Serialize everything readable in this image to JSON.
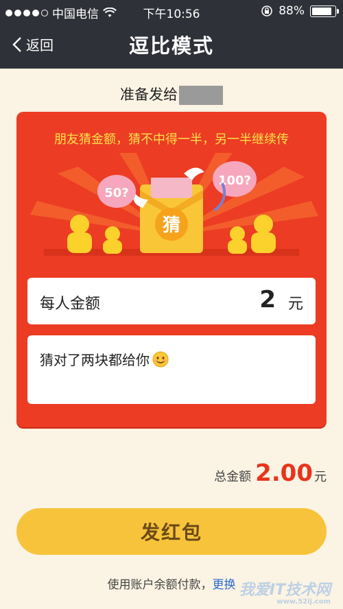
{
  "status_bar": {
    "carrier": "中国电信",
    "time": "下午10:56",
    "battery_percent": "88%",
    "battery_level": 0.88,
    "signal_bars_filled": 4
  },
  "nav": {
    "back_label": "返回",
    "title": "逗比模式"
  },
  "recipient": {
    "prefix": "准备发给"
  },
  "card": {
    "headline": "朋友猜金额，猜不中得一半，另一半继续传",
    "bubble_left": "50?",
    "bubble_right": "100?",
    "envelope_char": "猜",
    "amount_label": "每人金额",
    "amount_value": "2",
    "amount_unit": "元",
    "message": "猜对了两块都给你"
  },
  "total": {
    "label": "总金额",
    "value": "2.00",
    "unit": "元"
  },
  "send_button": "发红包",
  "footer": {
    "text": "使用账户余额付款，",
    "link": "更换"
  },
  "watermark": {
    "text": "我爱IT技术网",
    "url": "www.52ij.com"
  },
  "colors": {
    "nav_bg": "#2f3138",
    "page_bg": "#fbf3e3",
    "card_red": "#ec3c23",
    "headline_yellow": "#fde24a",
    "total_red": "#e8341b",
    "button_yellow": "#f7c33a"
  }
}
